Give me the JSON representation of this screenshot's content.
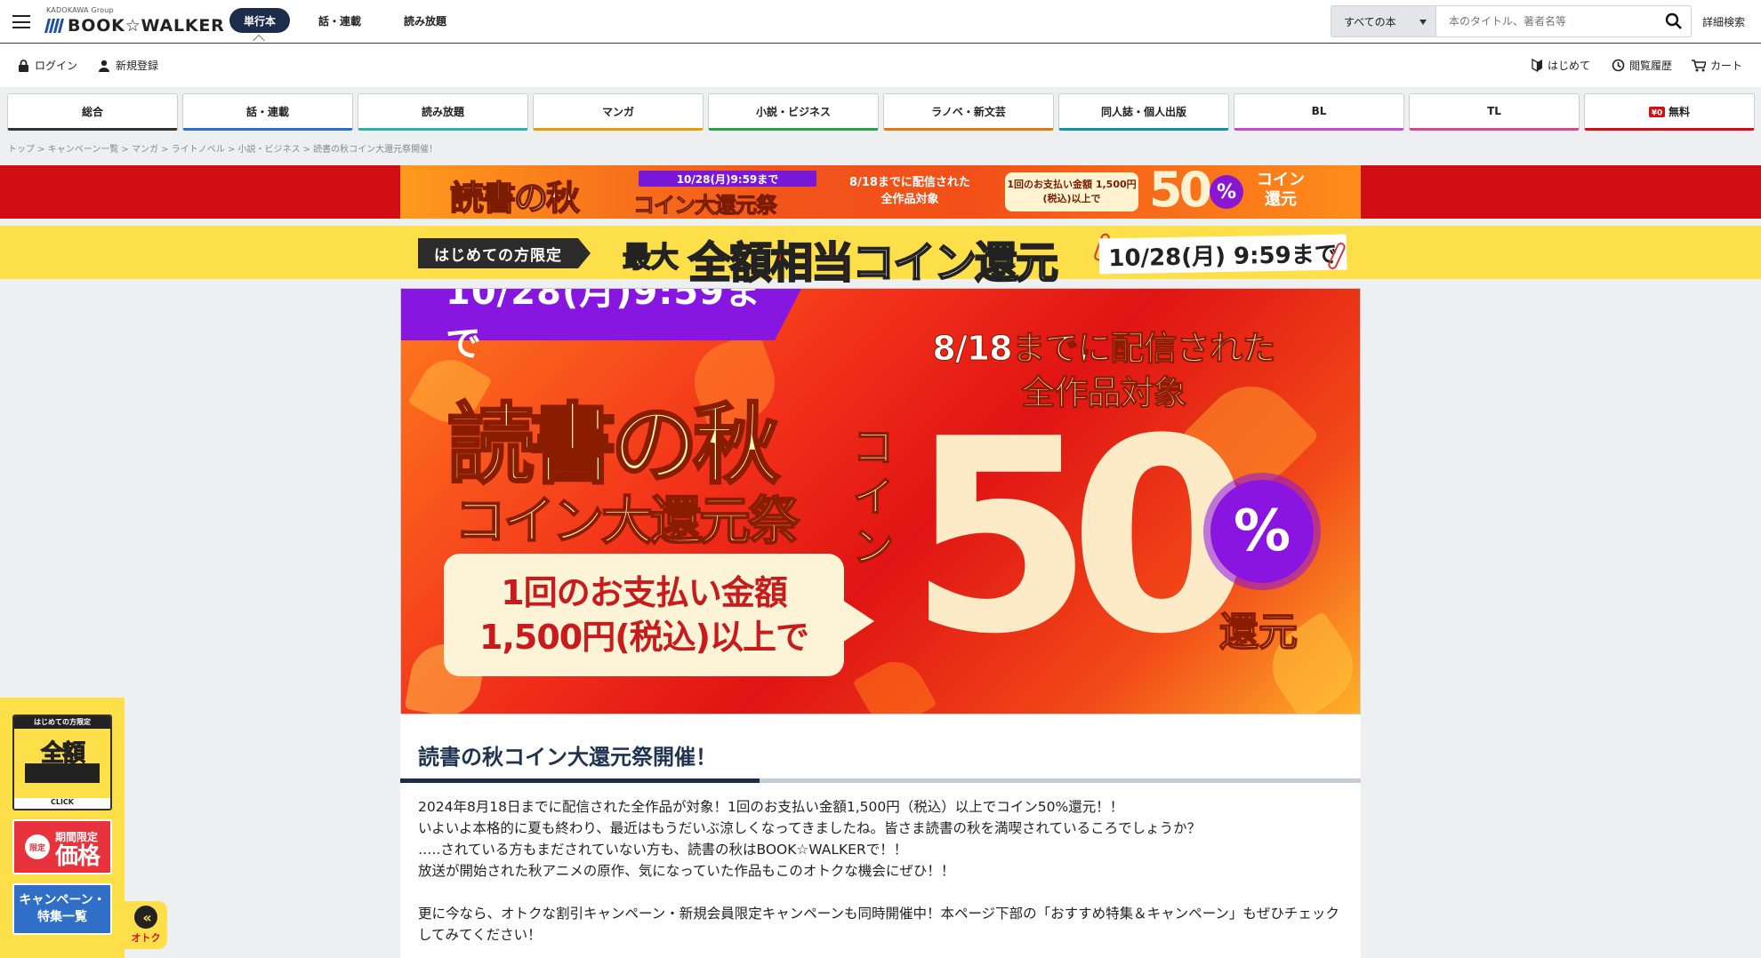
{
  "header": {
    "logo_group": "KADOKAWA Group",
    "logo_text": "BOOK☆WALKER",
    "tabs": [
      {
        "label": "単行本",
        "active": true
      },
      {
        "label": "話・連載",
        "active": false
      },
      {
        "label": "読み放題",
        "active": false
      }
    ],
    "search": {
      "scope": "すべての本",
      "placeholder": "本のタイトル、著者名等"
    },
    "advanced": "詳細検索"
  },
  "subheader": {
    "login": "ログイン",
    "register": "新規登録",
    "first_time": "はじめて",
    "history": "閲覧履歴",
    "cart": "カート"
  },
  "categories": [
    {
      "label": "総合",
      "color": "#333333"
    },
    {
      "label": "話・連載",
      "color": "#2f6fc8"
    },
    {
      "label": "読み放題",
      "color": "#2bb3a0"
    },
    {
      "label": "マンガ",
      "color": "#e0a000"
    },
    {
      "label": "小説・ビジネス",
      "color": "#2e9e4b"
    },
    {
      "label": "ラノベ・新文芸",
      "color": "#e07a10"
    },
    {
      "label": "同人誌・個人出版",
      "color": "#1b8f9c"
    },
    {
      "label": "BL",
      "color": "#c24bcf"
    },
    {
      "label": "TL",
      "color": "#d44b8a"
    },
    {
      "label": "無料",
      "color": "#d10e16"
    }
  ],
  "breadcrumb": "トップ > キャンペーン一覧 > マンガ > ライトノベル > 小説・ビジネス > 読書の秋コイン大還元祭開催！",
  "top_banner": {
    "title": "読書の秋",
    "date": "10/28(月)9:59まで",
    "subtitle": "コイン大還元祭",
    "condition": "8/18までに配信された 全作品対象",
    "payment": "1回のお支払い金額 1,500円(税込)以上で",
    "value": "50",
    "percent": "%",
    "coin": "コイン 還元"
  },
  "first_time_banner": {
    "tag": "はじめての方限定",
    "max": "最大",
    "main_red": "全額相当",
    "main_rest": "コイン還元",
    "date": "10/28(月) 9:59まで"
  },
  "hero": {
    "date": "10/28(月)9:59まで",
    "title": "読書の秋",
    "subtitle": "コイン大還元祭",
    "payment_line1": "1回のお支払い金額",
    "payment_line2": "1,500円(税込)以上で",
    "condition_line1": "8/18までに配信された",
    "condition_line2": "全作品対象",
    "vertical": "コイン",
    "value": "50",
    "percent": "%",
    "return": "還元"
  },
  "article": {
    "heading": "読書の秋コイン大還元祭開催！",
    "paragraphs": [
      "2024年8月18日までに配信された全作品が対象！1回のお支払い金額1,500円（税込）以上でコイン50%還元！！",
      "いよいよ本格的に夏も終わり、最近はもうだいぶ涼しくなってきましたね。皆さま読書の秋を満喫されているころでしょうか？",
      "…..されている方もまだされていない方も、読書の秋はBOOK☆WALKERで！！",
      "放送が開始された秋アニメの原作、気になっていた作品もこのオトクな機会にぜひ！！",
      "",
      "更に今なら、オトクな割引キャンペーン・新規会員限定キャンペーンも同時開催中！本ページ下部の「おすすめ特集＆キャンペーン」もぜひチェックしてみてください！"
    ]
  },
  "side_widget": {
    "w1_top": "はじめての方限定",
    "w1_a": "全額",
    "w1_b": "コイン還元",
    "w1_bottom": "CLICK",
    "w2_circle": "限定",
    "w2_small": "期間限定",
    "w2_large": "価格",
    "w3": "キャンペーン・特集一覧",
    "toggle_icon": "«",
    "toggle_label": "オトク"
  }
}
